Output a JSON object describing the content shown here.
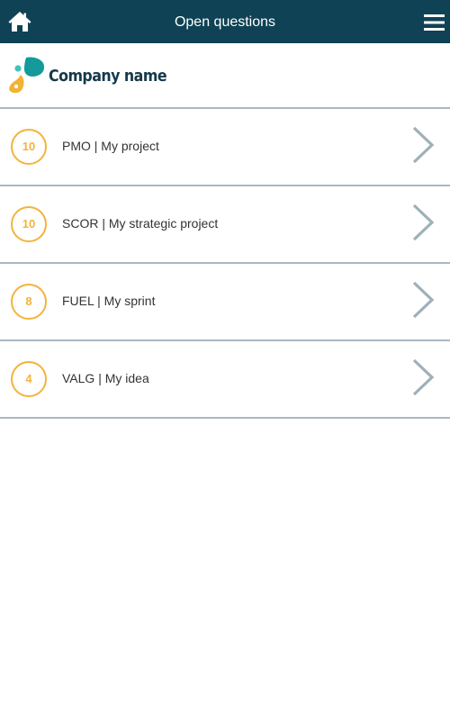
{
  "header": {
    "title": "Open questions",
    "home_icon": "home-icon",
    "menu_icon": "hamburger-menu-icon",
    "background_color": "#0f4255"
  },
  "brand": {
    "company_name": "Company name",
    "logo_icon": "droplet-logo-icon"
  },
  "accent_color": "#f3b33d",
  "items": [
    {
      "count": "10",
      "label": "PMO | My project"
    },
    {
      "count": "10",
      "label": "SCOR | My strategic project"
    },
    {
      "count": "8",
      "label": "FUEL | My sprint"
    },
    {
      "count": "4",
      "label": "VALG | My idea"
    }
  ]
}
